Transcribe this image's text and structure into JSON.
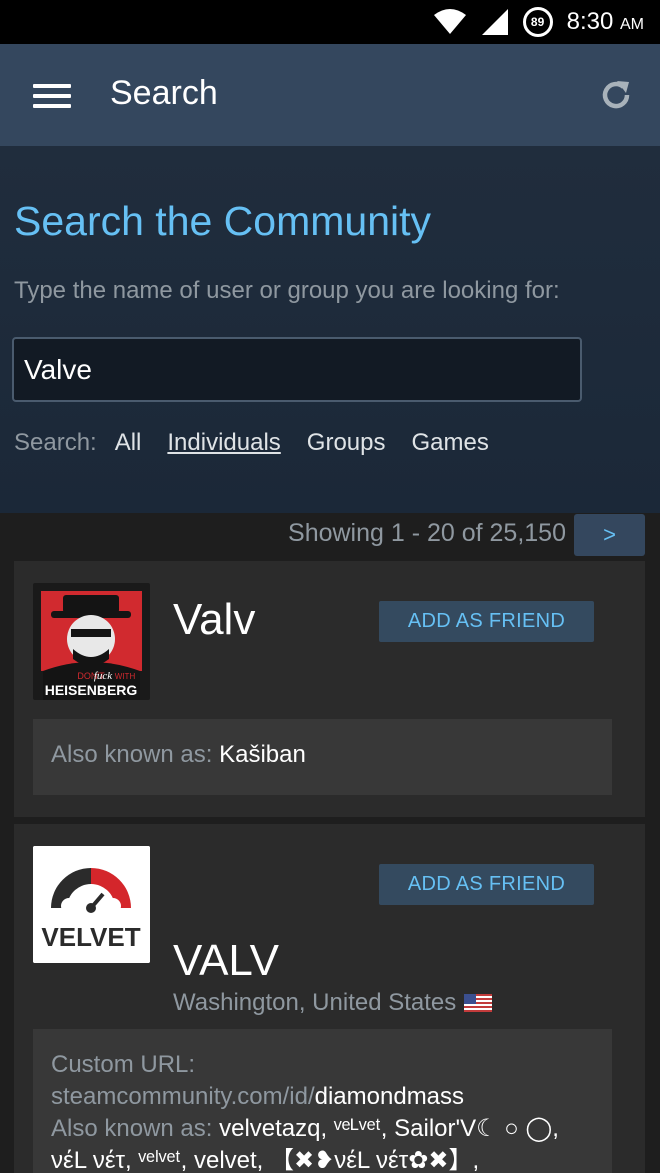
{
  "status_bar": {
    "battery": "89",
    "time": "8:30",
    "ampm": "AM"
  },
  "app_bar": {
    "title": "Search"
  },
  "search_panel": {
    "heading": "Search the Community",
    "hint": "Type the name of user or group you are looking for:",
    "query": "Valve",
    "filter_label": "Search:",
    "filters": [
      "All",
      "Individuals",
      "Groups",
      "Games"
    ],
    "active_filter": "Individuals"
  },
  "results": {
    "showing": "Showing 1 - 20 of 25,150",
    "next_label": ">",
    "items": [
      {
        "name": "Valv",
        "add_label": "ADD AS FRIEND",
        "avatar_text": [
          "DON'T",
          "fuck",
          "WITH",
          "HEISENBERG"
        ],
        "aka_label": "Also known as:",
        "aka": "Kašiban"
      },
      {
        "name": "VALV",
        "add_label": "ADD AS FRIEND",
        "avatar_text": "VELVET",
        "location": "Washington, United States",
        "custom_url_label": "Custom URL:",
        "custom_url_prefix": "steamcommunity.com/id/",
        "custom_url_id": "diamondmass",
        "aka_label": "Also known as:",
        "aka_line1": "velvetazq, ᵛᵉᴸᵛᵉᵗ, Sailor'V☾ ○ ◯,",
        "aka_line2": "νέL νέτ, ᵛᵉˡᵛᵉᵗ, velvet, 【✖❥νέL νέτ✿✖】,"
      }
    ]
  }
}
